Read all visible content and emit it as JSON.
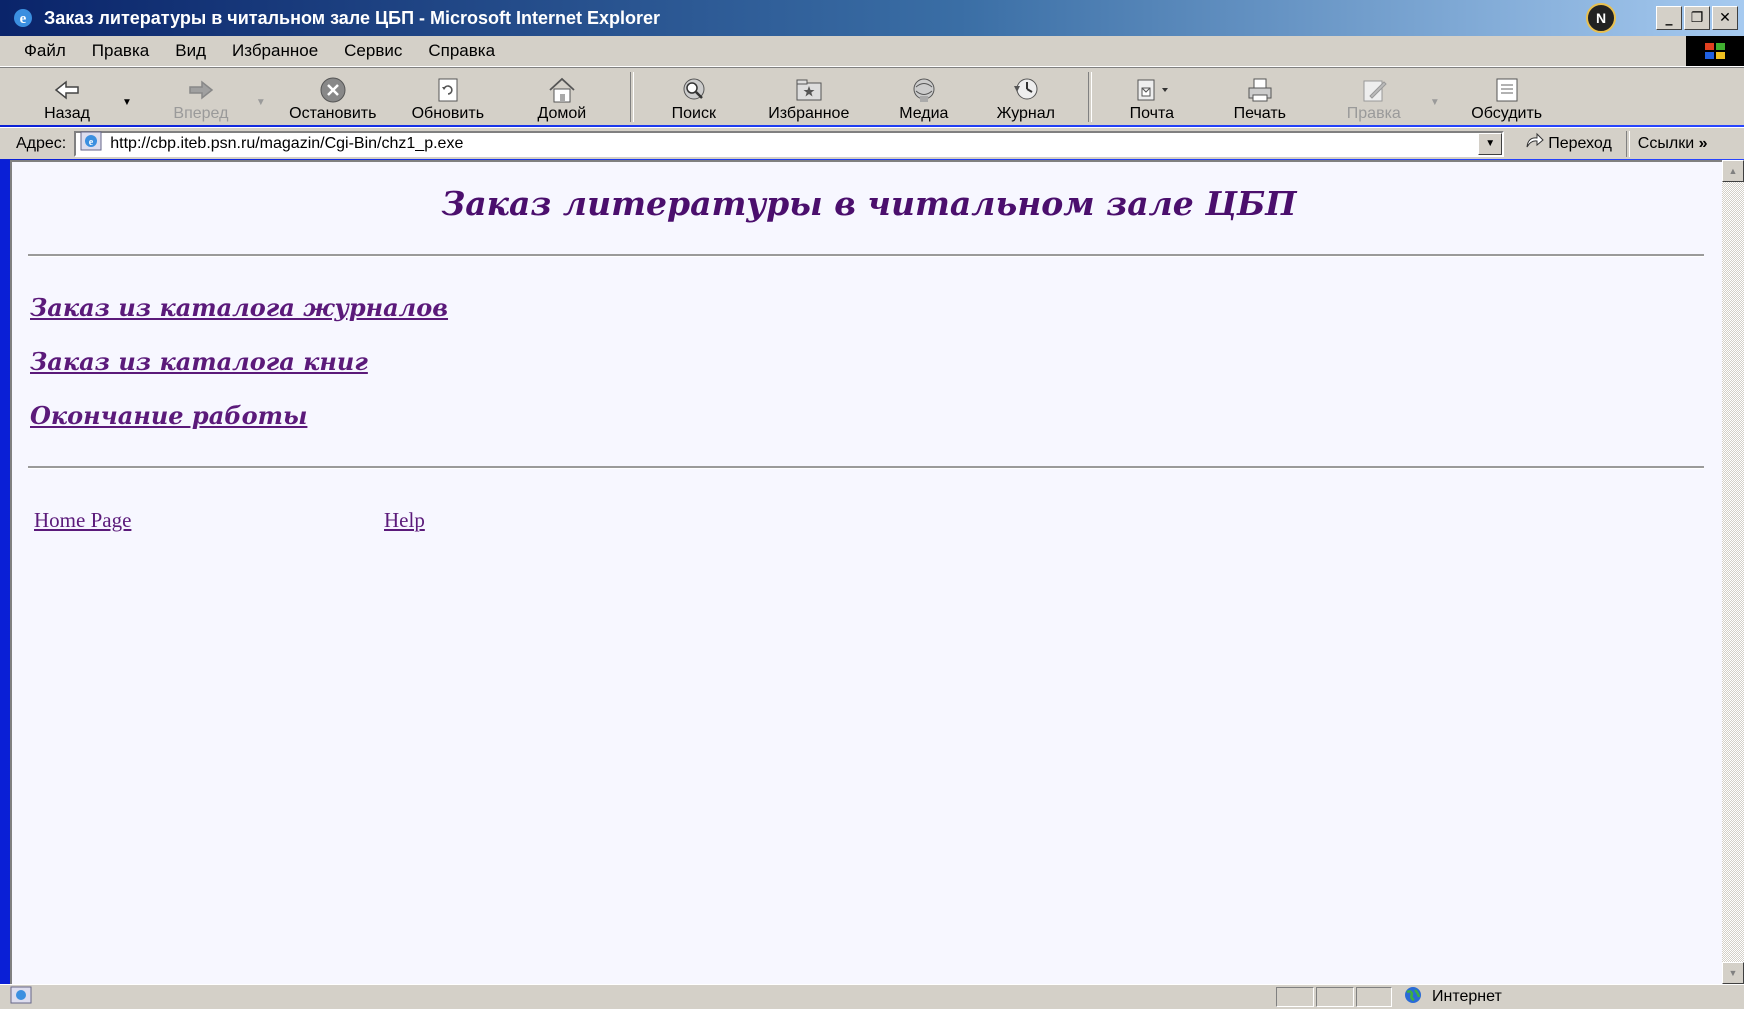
{
  "window": {
    "title": "Заказ литературы в читальном зале ЦБП - Microsoft Internet Explorer"
  },
  "menubar": {
    "items": [
      "Файл",
      "Правка",
      "Вид",
      "Избранное",
      "Сервис",
      "Справка"
    ]
  },
  "toolbar": {
    "back": {
      "label": "Назад",
      "icon": "back-arrow-icon",
      "enabled": true
    },
    "forward": {
      "label": "Вперед",
      "icon": "forward-arrow-icon",
      "enabled": false
    },
    "stop": {
      "label": "Остановить",
      "icon": "stop-icon",
      "enabled": true
    },
    "refresh": {
      "label": "Обновить",
      "icon": "refresh-icon",
      "enabled": true
    },
    "home": {
      "label": "Домой",
      "icon": "home-icon",
      "enabled": true
    },
    "search": {
      "label": "Поиск",
      "icon": "search-icon",
      "enabled": true
    },
    "favorites": {
      "label": "Избранное",
      "icon": "favorites-icon",
      "enabled": true
    },
    "media": {
      "label": "Медиа",
      "icon": "media-icon",
      "enabled": true
    },
    "history": {
      "label": "Журнал",
      "icon": "history-icon",
      "enabled": true
    },
    "mail": {
      "label": "Почта",
      "icon": "mail-icon",
      "enabled": true
    },
    "print": {
      "label": "Печать",
      "icon": "print-icon",
      "enabled": true
    },
    "edit": {
      "label": "Правка",
      "icon": "edit-icon",
      "enabled": false
    },
    "discuss": {
      "label": "Обсудить",
      "icon": "discuss-icon",
      "enabled": true
    }
  },
  "addressbar": {
    "label": "Адрес:",
    "url": "http://cbp.iteb.psn.ru/magazin/Cgi-Bin/chz1_p.exe",
    "go_label": "Переход",
    "links_label": "Ссылки"
  },
  "page": {
    "heading": "Заказ литературы в читальном зале ЦБП",
    "menu_links": [
      "Заказ из каталога журналов",
      "Заказ из каталога книг",
      "Окончание работы"
    ],
    "footer_links": {
      "home": "Home Page",
      "help": "Help"
    }
  },
  "statusbar": {
    "zone": "Интернет"
  },
  "colors": {
    "link": "#5b1a7a",
    "heading": "#4b0f6d",
    "page_bg": "#f7f7ff",
    "chrome": "#d4d0c8"
  }
}
